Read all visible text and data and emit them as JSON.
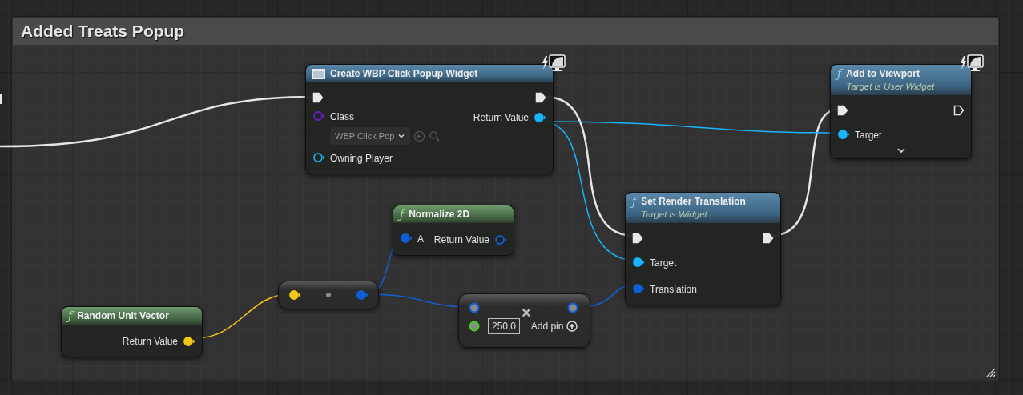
{
  "comment": {
    "title": "Added Treats Popup"
  },
  "nodes": [
    {
      "kind": "construct",
      "title": "Create WBP Click Popup Widget",
      "client_only": true,
      "expander": false,
      "inputs": [
        {
          "kind": "exec",
          "connected": true
        },
        {
          "kind": "data",
          "label": "Class",
          "color": "#6a1fc9",
          "connected": false,
          "input": {
            "kind": "dropdown",
            "value": "WBP Click Pop"
          }
        },
        {
          "kind": "data",
          "label": "Owning Player",
          "color": "#19a8e8",
          "connected": false
        }
      ],
      "outputs": [
        {
          "kind": "exec",
          "connected": true
        },
        {
          "kind": "data",
          "label": "Return Value",
          "color": "#19b4ff",
          "connected": true
        }
      ]
    },
    {
      "kind": "call",
      "glyph": "ƒ",
      "title": "Add to Viewport",
      "subtitle": "Target is User Widget",
      "client_only": true,
      "expander": true,
      "inputs": [
        {
          "kind": "exec",
          "connected": true
        },
        {
          "kind": "data",
          "label": "Target",
          "color": "#19b4ff",
          "connected": true
        }
      ],
      "outputs": [
        {
          "kind": "exec",
          "connected": false
        }
      ]
    },
    {
      "kind": "call",
      "glyph": "ƒ",
      "title": "Set Render Translation",
      "subtitle": "Target is Widget",
      "client_only": false,
      "expander": false,
      "inputs": [
        {
          "kind": "exec",
          "connected": true
        },
        {
          "kind": "data",
          "label": "Target",
          "color": "#19b4ff",
          "connected": true
        },
        {
          "kind": "data",
          "label": "Translation",
          "color": "#0f5fd8",
          "connected": true
        }
      ],
      "outputs": [
        {
          "kind": "exec",
          "connected": true
        }
      ]
    },
    {
      "kind": "pure",
      "glyph": "ƒ",
      "title": "Normalize 2D",
      "client_only": false,
      "expander": false,
      "inputs": [
        {
          "kind": "data",
          "label": "A",
          "color": "#0f5fd8",
          "connected": true
        }
      ],
      "outputs": [
        {
          "kind": "data",
          "label": "Return Value",
          "color": "#0f5fd8",
          "connected": false
        }
      ]
    },
    {
      "kind": "compact",
      "inputs": [
        {
          "kind": "data",
          "color": "#f5c518",
          "connected": true
        }
      ],
      "outputs": [
        {
          "kind": "data",
          "color": "#0f5fd8",
          "connected": true
        }
      ]
    },
    {
      "kind": "pure",
      "glyph": "ƒ",
      "title": "Random Unit Vector",
      "client_only": false,
      "expander": false,
      "outputs": [
        {
          "kind": "data",
          "label": "Return Value",
          "color": "#f5c518",
          "connected": true
        }
      ]
    },
    {
      "kind": "operator",
      "symbol": "×",
      "add_label": "Add pin",
      "inputs": [
        {
          "kind": "data",
          "color": "#0f5fd8"
        },
        {
          "kind": "data",
          "color": "#3fd416",
          "input": {
            "kind": "text",
            "value": "250,0"
          }
        }
      ],
      "outputs": [
        {
          "kind": "data",
          "color": "#0f5fd8"
        }
      ]
    }
  ]
}
